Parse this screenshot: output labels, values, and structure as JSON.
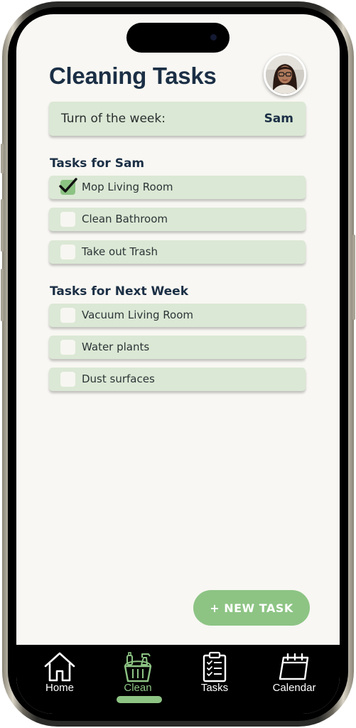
{
  "header": {
    "title": "Cleaning Tasks"
  },
  "turn": {
    "label": "Turn of the week:",
    "name": "Sam"
  },
  "sections": [
    {
      "title": "Tasks for Sam",
      "tasks": [
        {
          "label": "Mop Living Room",
          "checked": true
        },
        {
          "label": "Clean Bathroom",
          "checked": false
        },
        {
          "label": "Take out Trash",
          "checked": false
        }
      ]
    },
    {
      "title": "Tasks for Next Week",
      "tasks": [
        {
          "label": "Vacuum Living Room",
          "checked": false
        },
        {
          "label": "Water plants",
          "checked": false
        },
        {
          "label": "Dust surfaces",
          "checked": false
        }
      ]
    }
  ],
  "actions": {
    "new_task_label": "+ NEW TASK"
  },
  "tabbar": {
    "active": "clean",
    "tabs": [
      {
        "id": "home",
        "label": "Home",
        "icon": "house-icon"
      },
      {
        "id": "clean",
        "label": "Clean",
        "icon": "cleaning-basket-icon"
      },
      {
        "id": "tasks",
        "label": "Tasks",
        "icon": "clipboard-checklist-icon"
      },
      {
        "id": "calendar",
        "label": "Calendar",
        "icon": "calendar-icon"
      }
    ]
  },
  "colors": {
    "accent": "#8dc484",
    "card": "#dbe8d5",
    "title": "#1b2f45",
    "background": "#f8f7f3",
    "tabbar": "#000000"
  }
}
